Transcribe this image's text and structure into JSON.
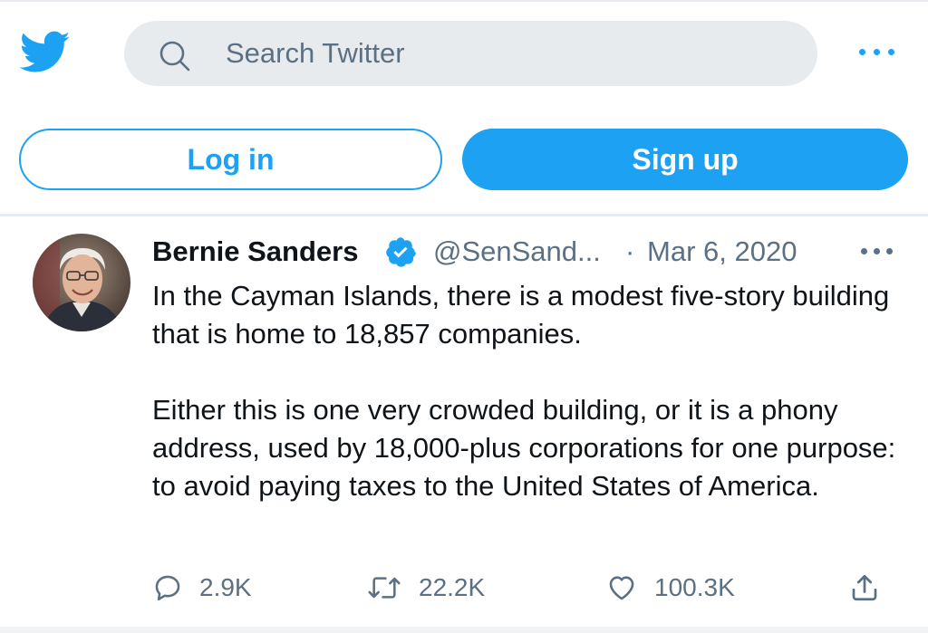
{
  "header": {
    "logo_icon": "twitter-bird-icon",
    "search": {
      "icon": "search-icon",
      "placeholder": "Search Twitter",
      "value": ""
    },
    "more_icon": "more-horizontal-icon"
  },
  "auth": {
    "login_label": "Log in",
    "signup_label": "Sign up"
  },
  "tweet": {
    "author_name": "Bernie Sanders",
    "verified_icon": "verified-badge-icon",
    "handle": "@SenSand...",
    "separator": "·",
    "date": "Mar 6, 2020",
    "more_icon": "more-horizontal-icon",
    "text": [
      "In the Cayman Islands, there is a modest five-story building that is home to 18,857 companies.",
      "Either this is one very crowded building, or it is a phony address, used by 18,000-plus corporations for one purpose: to avoid paying taxes to the United States of America."
    ],
    "stats": {
      "replies": "2.9K",
      "retweets": "22.2K",
      "likes": "100.3K"
    },
    "action_icons": [
      "reply-icon",
      "retweet-icon",
      "like-icon",
      "share-icon"
    ]
  },
  "colors": {
    "accent": "#1da1f2",
    "secondary_text": "#5b7083",
    "primary_text": "#0f1419",
    "search_bg": "#e8ebed",
    "divider": "#e6ecf0"
  }
}
